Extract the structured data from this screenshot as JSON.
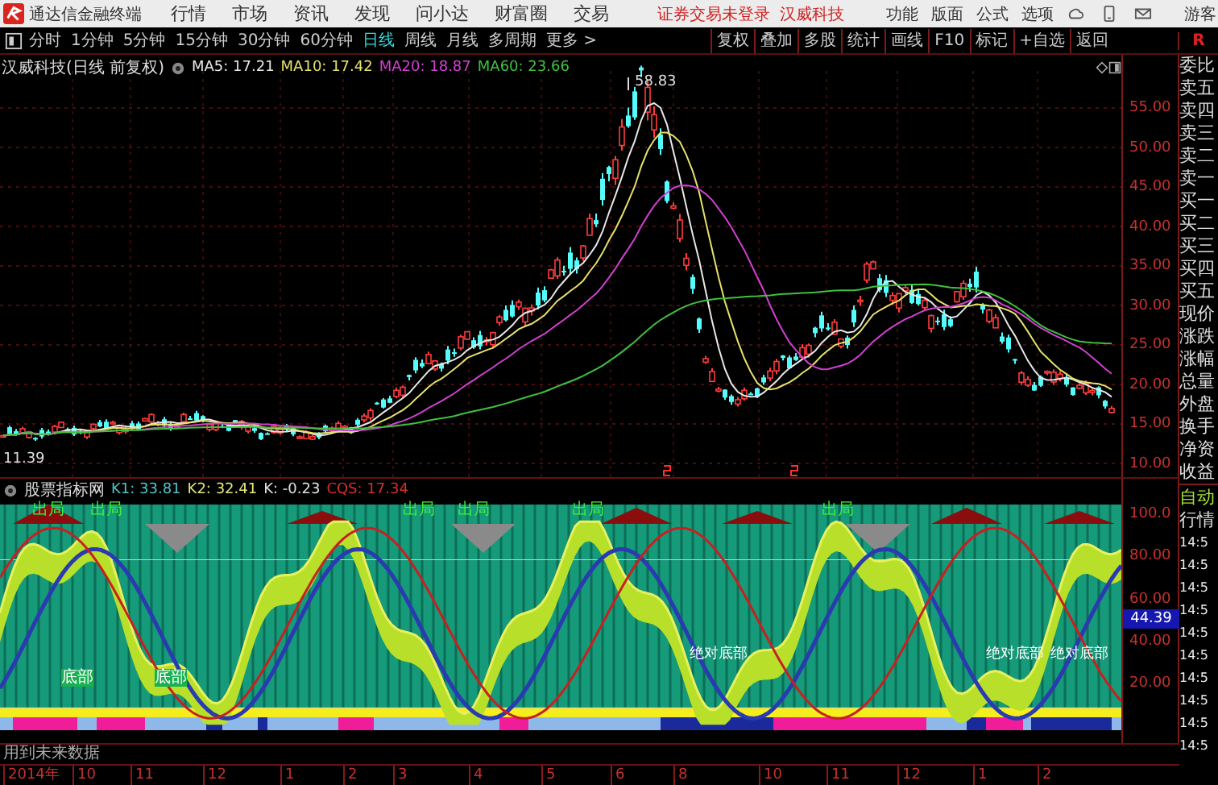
{
  "app_bar": {
    "title": "通达信金融终端",
    "menu": [
      "行情",
      "市场",
      "资讯",
      "发现",
      "问小达",
      "财富圈",
      "交易"
    ],
    "login_status": "证券交易未登录",
    "stock_name": "汉威科技",
    "tools": [
      "功能",
      "版面",
      "公式",
      "选项"
    ],
    "user": "游客"
  },
  "period_bar": {
    "periods": [
      {
        "label": "分时",
        "selected": false
      },
      {
        "label": "1分钟",
        "selected": false
      },
      {
        "label": "5分钟",
        "selected": false
      },
      {
        "label": "15分钟",
        "selected": false
      },
      {
        "label": "30分钟",
        "selected": false
      },
      {
        "label": "60分钟",
        "selected": false
      },
      {
        "label": "日线",
        "selected": true
      },
      {
        "label": "周线",
        "selected": false
      },
      {
        "label": "月线",
        "selected": false
      },
      {
        "label": "多周期",
        "selected": false
      },
      {
        "label": "更多 >",
        "selected": false
      }
    ],
    "actions": [
      "复权",
      "叠加",
      "多股",
      "统计",
      "画线",
      "F10",
      "标记",
      "+自选",
      "返回"
    ],
    "side_label": "R"
  },
  "main_chart": {
    "title": "汉威科技(日线 前复权)",
    "ma": [
      {
        "label": "MA5: 17.21",
        "color": "#e8e8e8"
      },
      {
        "label": "MA10: 17.42",
        "color": "#e6e26a"
      },
      {
        "label": "MA20: 18.87",
        "color": "#d040d0"
      },
      {
        "label": "MA60: 23.66",
        "color": "#40c040"
      }
    ],
    "high_label": "58.83",
    "low_label": "11.39",
    "y_labels": [
      "55.00",
      "50.00",
      "45.00",
      "40.00",
      "35.00",
      "30.00",
      "25.00",
      "20.00",
      "15.00",
      "10.00"
    ]
  },
  "quote_panel": {
    "labels": [
      "委比",
      "卖五",
      "卖四",
      "卖三",
      "卖二",
      "卖一",
      "买一",
      "买二",
      "买三",
      "买四",
      "买五",
      "现价",
      "涨跌",
      "涨幅",
      "总量",
      "外盘",
      "换手",
      "净资",
      "收益"
    ],
    "mode": "自动",
    "tab": "行情",
    "times": [
      "14:5",
      "14:5",
      "14:5",
      "14:5",
      "14:5",
      "14:5",
      "14:5",
      "14:5",
      "14:5",
      "14:5"
    ]
  },
  "indicator": {
    "name": "股票指标网",
    "values": [
      {
        "label": "K1: 33.81",
        "color": "#4fc3c8"
      },
      {
        "label": "K2: 32.41",
        "color": "#e6e67a"
      },
      {
        "label": "K: -0.23",
        "color": "#e0e0e0"
      },
      {
        "label": "CQS: 17.34",
        "color": "#d03030"
      }
    ],
    "exit_signals": [
      "出局",
      "出局",
      "出局",
      "出局",
      "出局",
      "出局"
    ],
    "bottom_signals": [
      "底部",
      "底部"
    ],
    "notes": [
      "绝对底部",
      "绝对底部",
      "绝对底部"
    ],
    "y_labels": [
      "100.0",
      "80.00",
      "60.00",
      "40.00",
      "20.00"
    ],
    "current": "44.39"
  },
  "footer": {
    "warning": "用到未来数据",
    "dates": [
      "2014年",
      "10",
      "11",
      "12",
      "1",
      "2",
      "3",
      "4",
      "5",
      "6",
      "8",
      "10",
      "11",
      "12",
      "1",
      "2"
    ]
  }
}
